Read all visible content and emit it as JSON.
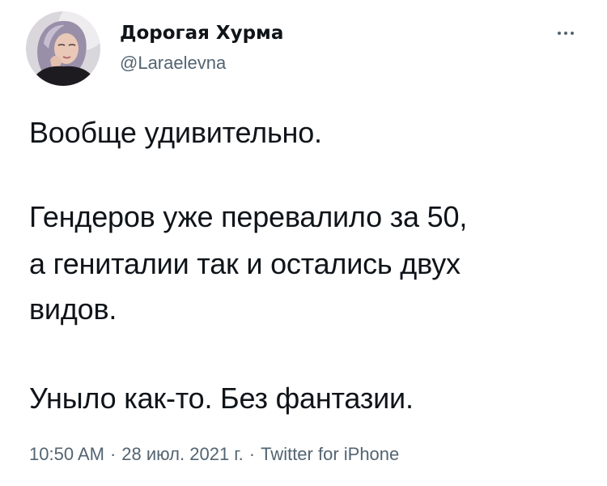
{
  "author": {
    "display_name": "Дорогая Хурма",
    "handle": "@Laraelevna",
    "avatar_icon": "profile-photo",
    "more_icon": "more-options-icon"
  },
  "tweet": {
    "line1": "Вообще удивительно.",
    "line2": "Гендеров уже перевалило за 50,",
    "line3": "а гениталии так и остались двух",
    "line4": "видов.",
    "line5": "Уныло как-то. Без фантазии."
  },
  "meta": {
    "time": "10:50 AM",
    "date": "28 июл. 2021 г.",
    "separator": "·",
    "source": "Twitter for iPhone"
  },
  "colors": {
    "text": "#0f1419",
    "secondary": "#536471",
    "background": "#ffffff"
  }
}
